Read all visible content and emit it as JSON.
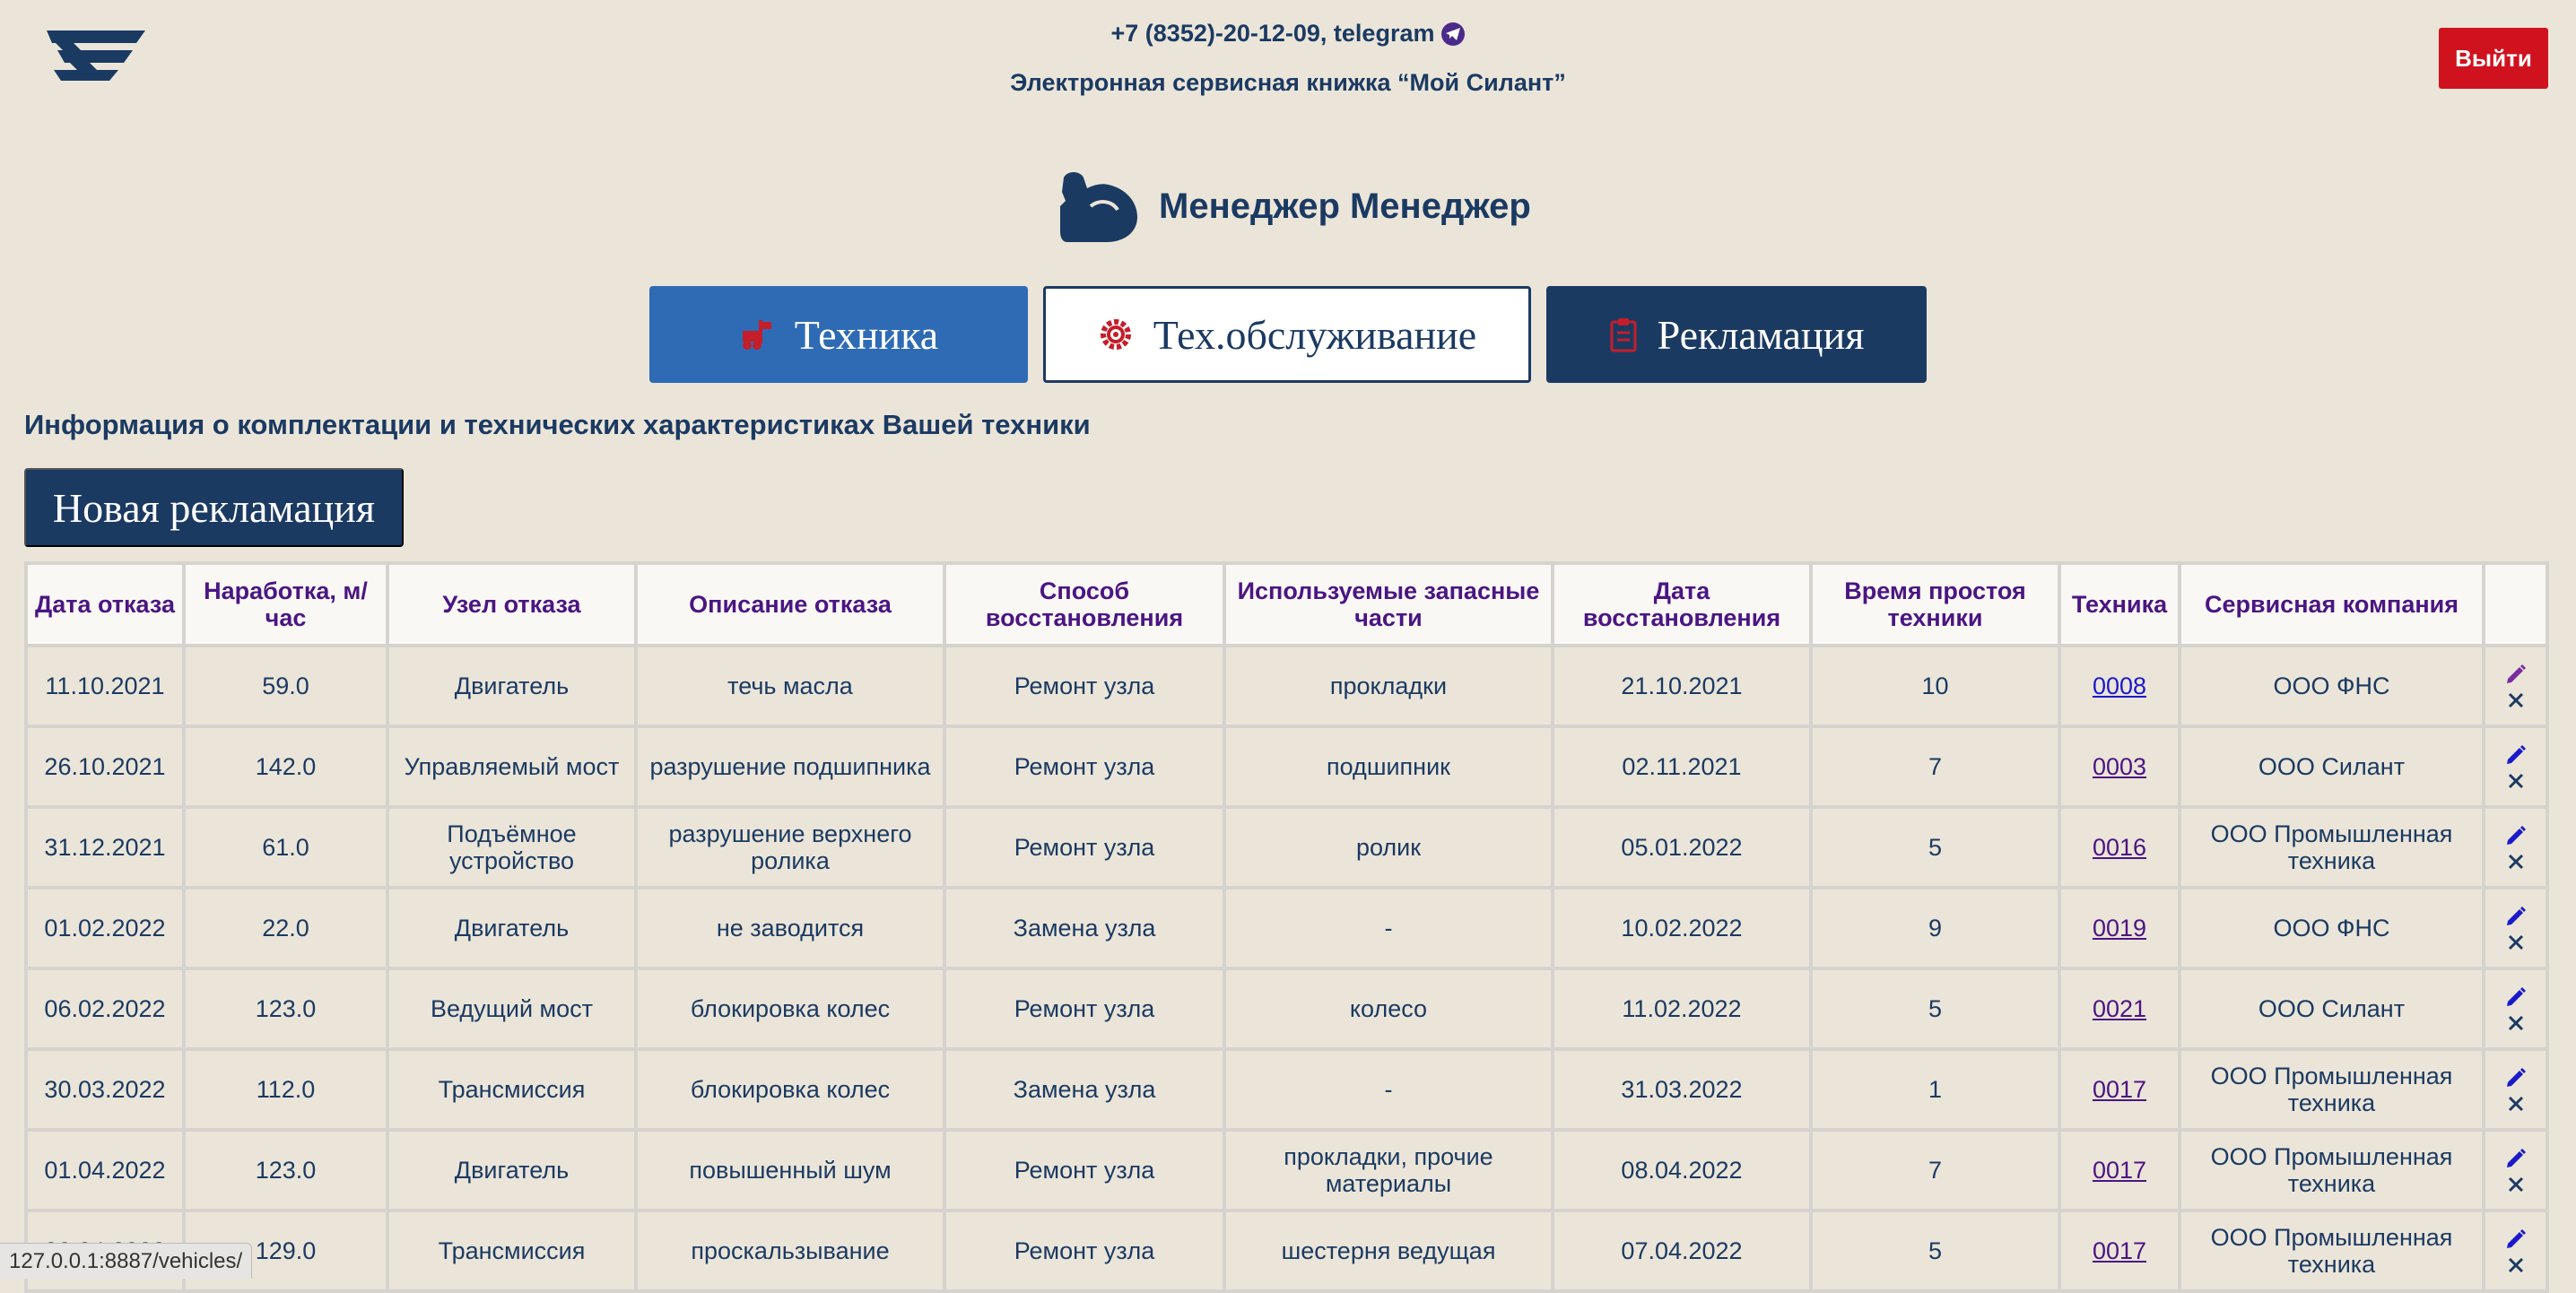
{
  "header": {
    "phone": "+7 (8352)-20-12-09, telegram",
    "subtitle": "Электронная сервисная книжка “Мой Силант”",
    "logout_label": "Выйти"
  },
  "user": {
    "name": "Менеджер Менеджер"
  },
  "tabs": [
    {
      "label": "Техника",
      "icon": "forklift-icon",
      "state": "active"
    },
    {
      "label": "Тех.обслуживание",
      "icon": "gear-icon",
      "state": "outlined"
    },
    {
      "label": "Рекламация",
      "icon": "clipboard-icon",
      "state": "dark"
    }
  ],
  "section_title": "Информация о комплектации и технических характеристиках Вашей техники",
  "new_button_label": "Новая рекламация",
  "table": {
    "headers": [
      "Дата отказа",
      "Наработка, м/час",
      "Узел отказа",
      "Описание отказа",
      "Способ восстановления",
      "Используемые запасные части",
      "Дата восстановления",
      "Время простоя техники",
      "Техника",
      "Сервисная компания",
      ""
    ],
    "rows": [
      [
        "11.10.2021",
        "59.0",
        "Двигатель",
        "течь масла",
        "Ремонт узла",
        "прокладки",
        "21.10.2021",
        "10",
        "0008",
        "ООО ФНС"
      ],
      [
        "26.10.2021",
        "142.0",
        "Управляемый мост",
        "разрушение подшипника",
        "Ремонт узла",
        "подшипник",
        "02.11.2021",
        "7",
        "0003",
        "ООО Силант"
      ],
      [
        "31.12.2021",
        "61.0",
        "Подъёмное устройство",
        "разрушение верхнего ролика",
        "Ремонт узла",
        "ролик",
        "05.01.2022",
        "5",
        "0016",
        "ООО Промышленная техника"
      ],
      [
        "01.02.2022",
        "22.0",
        "Двигатель",
        "не заводится",
        "Замена узла",
        "-",
        "10.02.2022",
        "9",
        "0019",
        "ООО ФНС"
      ],
      [
        "06.02.2022",
        "123.0",
        "Ведущий мост",
        "блокировка колес",
        "Ремонт узла",
        "колесо",
        "11.02.2022",
        "5",
        "0021",
        "ООО Силант"
      ],
      [
        "30.03.2022",
        "112.0",
        "Трансмиссия",
        "блокировка колес",
        "Замена узла",
        "-",
        "31.03.2022",
        "1",
        "0017",
        "ООО Промышленная техника"
      ],
      [
        "01.04.2022",
        "123.0",
        "Двигатель",
        "повышенный шум",
        "Ремонт узла",
        "прокладки, прочие материалы",
        "08.04.2022",
        "7",
        "0017",
        "ООО Промышленная техника"
      ],
      [
        "02.04.2022",
        "129.0",
        "Трансмиссия",
        "проскальзывание",
        "Ремонт узла",
        "шестерня ведущая",
        "07.04.2022",
        "5",
        "0017",
        "ООО Промышленная техника"
      ]
    ]
  },
  "status_bar": {
    "url": "127.0.0.1:8887/vehicles/"
  },
  "colors": {
    "background": "#ebe5d9",
    "primary_dark": "#1b3a62",
    "primary_blue": "#2e6bb4",
    "logout_red": "#d0121f",
    "header_text": "#4b1582"
  }
}
